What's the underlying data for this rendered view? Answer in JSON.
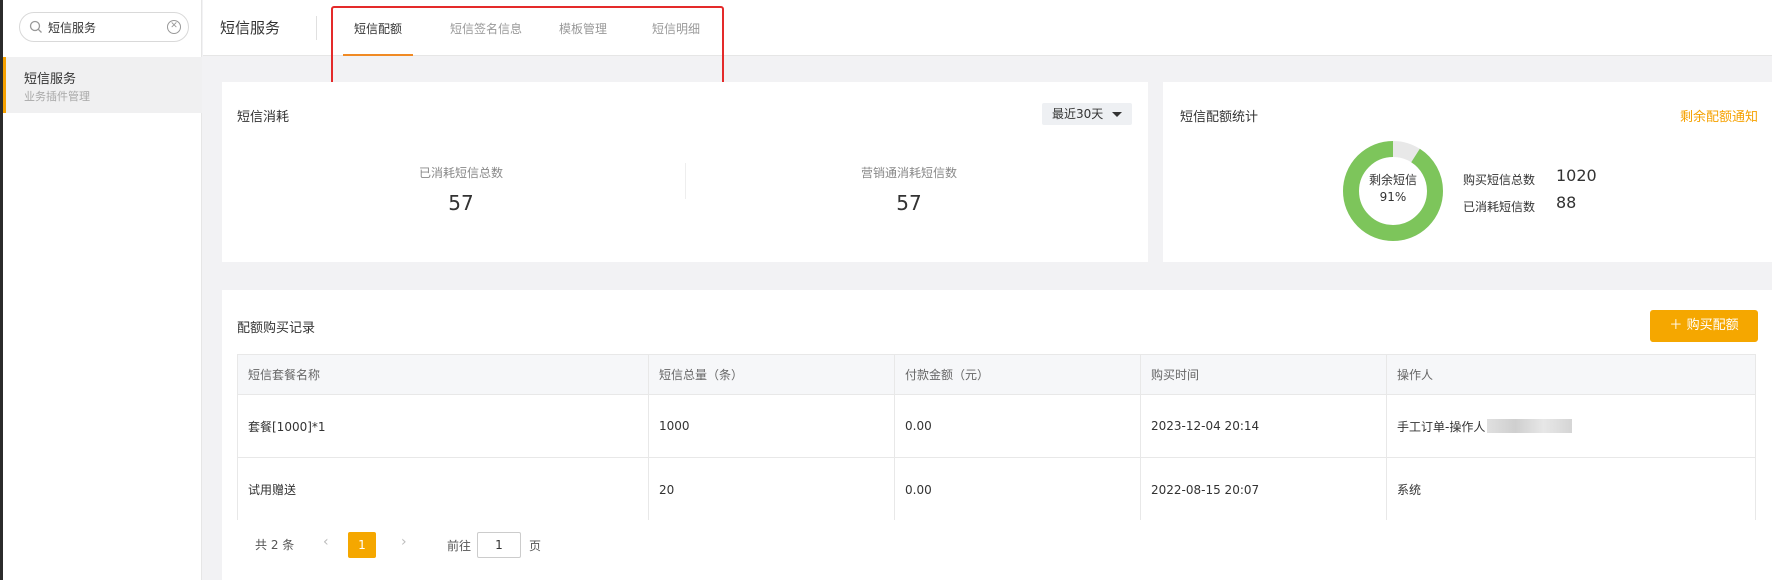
{
  "sidebar": {
    "search_value": "短信服务",
    "item_title": "短信服务",
    "item_subtitle": "业务插件管理"
  },
  "header": {
    "title": "短信服务",
    "tabs": [
      {
        "label": "短信配额",
        "active": true
      },
      {
        "label": "短信签名信息",
        "active": false
      },
      {
        "label": "模板管理",
        "active": false
      },
      {
        "label": "短信明细",
        "active": false
      }
    ]
  },
  "consumption": {
    "title": "短信消耗",
    "range_label": "最近30天",
    "stats": [
      {
        "label": "已消耗短信总数",
        "value": "57"
      },
      {
        "label": "营销通消耗短信数",
        "value": "57"
      }
    ]
  },
  "quota": {
    "title": "短信配额统计",
    "notify_link": "剩余配额通知",
    "donut_label": "剩余短信",
    "donut_percent": "91%",
    "remaining_fraction": 0.91,
    "colors": {
      "remaining": "#7dc55b",
      "used": "#e8e8e8"
    },
    "legend": [
      {
        "label": "购买短信总数",
        "value": "1020"
      },
      {
        "label": "已消耗短信数",
        "value": "88"
      }
    ]
  },
  "records": {
    "title": "配额购买记录",
    "buy_button": "购买配额",
    "columns": [
      "短信套餐名称",
      "短信总量（条）",
      "付款金额（元）",
      "购买时间",
      "操作人"
    ],
    "rows": [
      [
        "套餐[1000]*1",
        "1000",
        "0.00",
        "2023-12-04 20:14",
        "手工订单-操作人"
      ],
      [
        "试用赠送",
        "20",
        "0.00",
        "2022-08-15 20:07",
        "系统"
      ]
    ]
  },
  "pager": {
    "total": "共 2 条",
    "prev": "‹",
    "next": "›",
    "current_page": "1",
    "goto_label": "前往",
    "goto_value": "1",
    "goto_unit": "页"
  },
  "accent_color": "#f5a700"
}
